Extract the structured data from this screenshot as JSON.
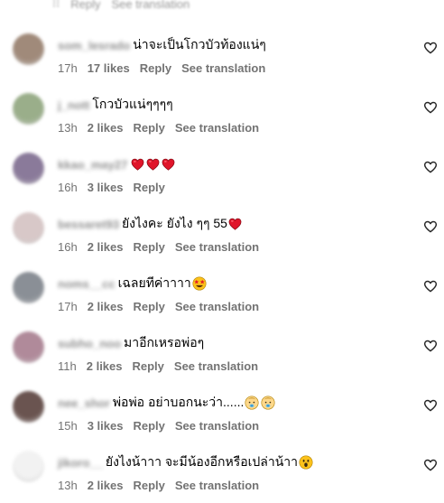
{
  "top_partial": {
    "reply_label": "Reply",
    "translation_label": "See translation"
  },
  "comments": [
    {
      "username": "som_lesrado",
      "text": "น่าจะเป็นโกวบัวท้องแน่ๆ",
      "emoji": "",
      "time": "17h",
      "likes": "17 likes",
      "reply_label": "Reply",
      "translation_label": "See translation",
      "avatar_color": "#a08a7a"
    },
    {
      "username": "j_nott",
      "text": "โกวบัวแน่ๆๆๆๆ",
      "emoji": "",
      "time": "13h",
      "likes": "2 likes",
      "reply_label": "Reply",
      "translation_label": "See translation",
      "avatar_color": "#9aae8a"
    },
    {
      "username": "kkao_may27",
      "text": "",
      "emoji": "heart-x3",
      "time": "16h",
      "likes": "3 likes",
      "reply_label": "Reply",
      "translation_label": "",
      "avatar_color": "#8a7a9a"
    },
    {
      "username": "bessaret93",
      "text": "ยังไงคะ ยังไง ๆๆ 55",
      "emoji": "heart",
      "time": "16h",
      "likes": "2 likes",
      "reply_label": "Reply",
      "translation_label": "See translation",
      "avatar_color": "#d8c8c8"
    },
    {
      "username": "noms__cc",
      "text": "เฉลยทีค่าาาา",
      "emoji": "star-eyes",
      "time": "17h",
      "likes": "2 likes",
      "reply_label": "Reply",
      "translation_label": "See translation",
      "avatar_color": "#8a8f96"
    },
    {
      "username": "subho_noo",
      "text": "มาอีกเหรอพ่อๆ",
      "emoji": "",
      "time": "11h",
      "likes": "2 likes",
      "reply_label": "Reply",
      "translation_label": "See translation",
      "avatar_color": "#b08a9a"
    },
    {
      "username": "nee_shor",
      "text": "พ่อพ่อ อย่าบอกนะว่า......",
      "emoji": "baby-x2",
      "time": "15h",
      "likes": "3 likes",
      "reply_label": "Reply",
      "translation_label": "See translation",
      "avatar_color": "#6a5450"
    },
    {
      "username": "jikoro__",
      "text": "ยังไงน้าาา จะมีน้องอีกหรือเปล่าน้าา",
      "emoji": "surprised",
      "time": "13h",
      "likes": "2 likes",
      "reply_label": "Reply",
      "translation_label": "See translation",
      "avatar_color": "#f2f2f2"
    }
  ],
  "icon_names": {
    "like": "heart-outline-icon"
  },
  "colors": {
    "meta": "#737373",
    "heart": "#e0152a"
  }
}
